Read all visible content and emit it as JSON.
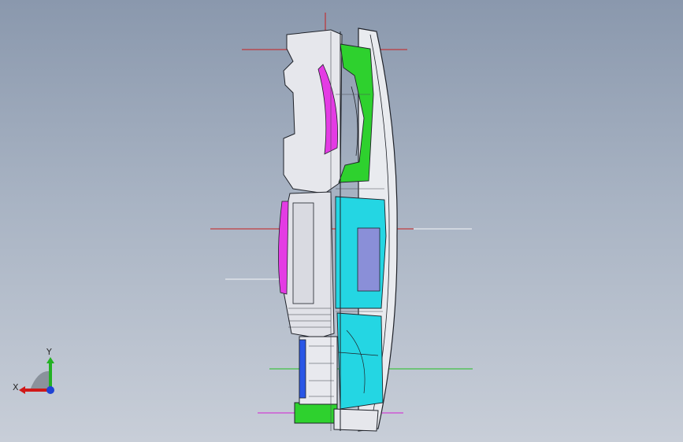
{
  "window": {
    "title": ""
  },
  "viewport": {
    "background_top": "#8a98ad",
    "background_bottom": "#c8ced8",
    "model_colors": {
      "housing": "#e7e8ee",
      "magenta_part": "#e43be4",
      "green_part": "#2ed12e",
      "cyan_part": "#24d6e3",
      "blue_part": "#2956e6",
      "outline": "#1f2229"
    }
  },
  "triad": {
    "x_label": "X",
    "y_label": "Y",
    "x_color": "#d01818",
    "y_color": "#23b123",
    "z_color": "#1f42d4",
    "icons": [
      "coordinate-triad-icon"
    ]
  }
}
